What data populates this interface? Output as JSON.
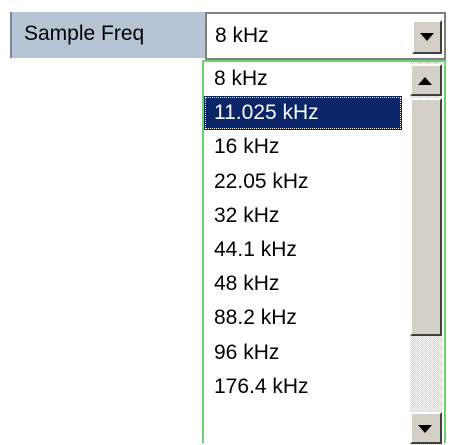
{
  "field": {
    "label": "Sample Freq",
    "value": "8 kHz"
  },
  "dropdown": {
    "options": [
      "8 kHz",
      "11.025 kHz",
      "16 kHz",
      "22.05 kHz",
      "32 kHz",
      "44.1 kHz",
      "48 kHz",
      "88.2 kHz",
      "96 kHz",
      "176.4 kHz"
    ],
    "highlighted": "11.025 kHz"
  },
  "colors": {
    "label_bg": "#b7c4d6",
    "highlight_bg": "#0a246a",
    "dropdown_border": "#6cd46c",
    "button_face": "#d4d0c8"
  },
  "icons": {
    "combo_button": "chevron-down-icon",
    "scroll_up": "arrow-up-icon",
    "scroll_down": "arrow-down-icon"
  }
}
